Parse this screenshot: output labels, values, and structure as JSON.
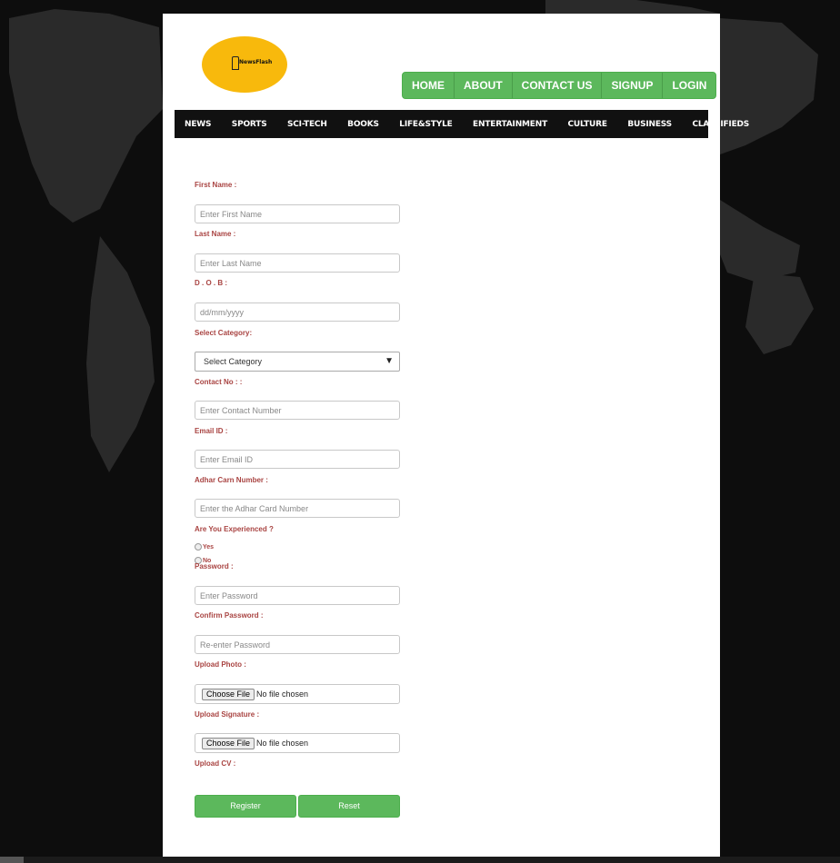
{
  "logo": {
    "text": "NewsFlash",
    "icon": "pen-icon"
  },
  "top_nav": [
    "HOME",
    "ABOUT",
    "CONTACT US",
    "SIGNUP",
    "LOGIN"
  ],
  "categories": [
    "NEWS",
    "SPORTS",
    "SCI-TECH",
    "BOOKS",
    "LIFE&STYLE",
    "ENTERTAINMENT",
    "CULTURE",
    "BUSINESS",
    "CLASSIFIEDS"
  ],
  "form": {
    "first_name_label": "First Name :",
    "first_name_placeholder": "Enter First Name",
    "last_name_label": "Last Name :",
    "last_name_placeholder": "Enter Last Name",
    "dob_label": "D . O . B :",
    "dob_placeholder": "dd/mm/yyyy",
    "category_label": "Select Category:",
    "category_value": "Select Category",
    "contact_label": "Contact No : :",
    "contact_placeholder": "Enter Contact Number",
    "email_label": "Email ID :",
    "email_placeholder": "Enter Email ID",
    "adhar_label": "Adhar Carn Number :",
    "adhar_placeholder": "Enter the Adhar Card Number",
    "experienced_label": "Are You Experienced ?",
    "yes_label": "Yes",
    "no_label": "No",
    "password_label": "Password :",
    "password_placeholder": "Enter Password",
    "confirm_label": "Confirm Password :",
    "confirm_placeholder": "Re-enter Password",
    "photo_label": "Upload Photo :",
    "signature_label": "Upload Signature :",
    "cv_label": "Upload CV :",
    "choose_file": "Choose File",
    "no_file": "No file chosen",
    "register": "Register",
    "reset": "Reset"
  },
  "colors": {
    "accent_green": "#5cb85c",
    "label_red": "#a94442",
    "logo_yellow": "#f8b90c"
  }
}
